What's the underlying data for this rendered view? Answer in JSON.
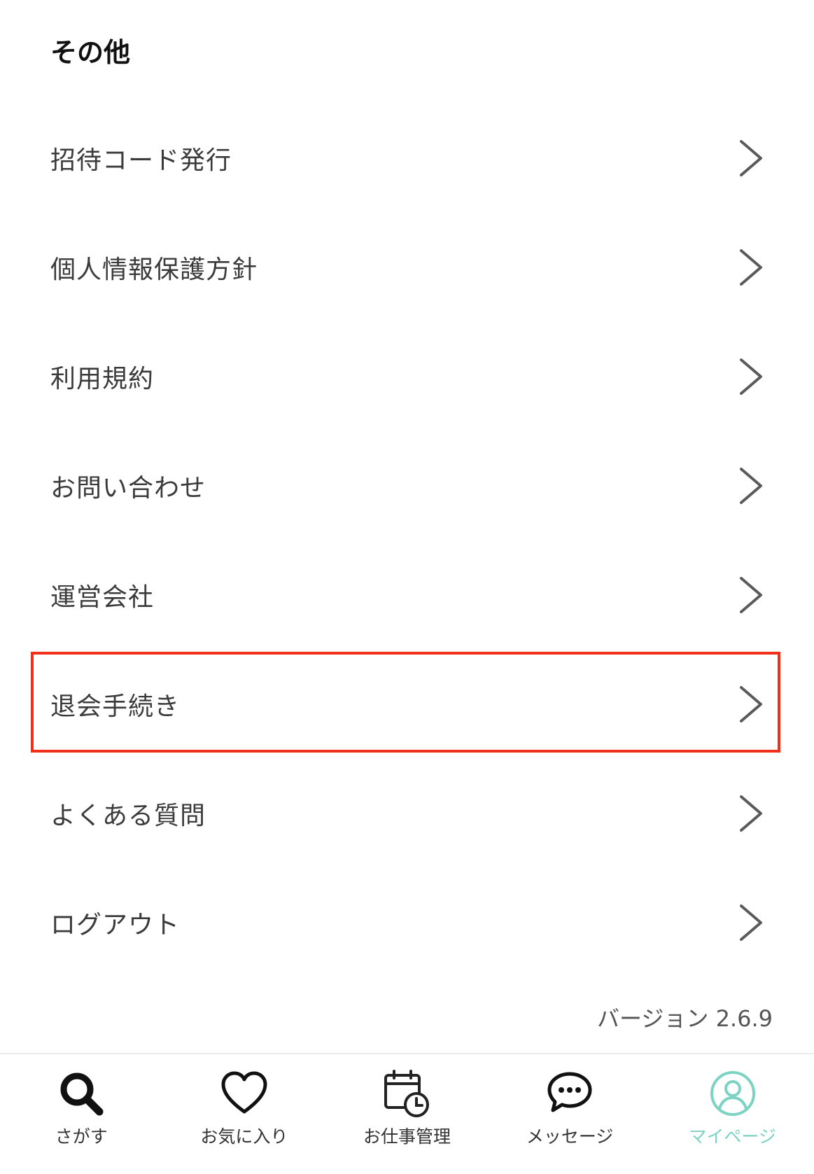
{
  "section": {
    "title": "その他"
  },
  "menu": {
    "items": [
      {
        "label": "招待コード発行"
      },
      {
        "label": "個人情報保護方針"
      },
      {
        "label": "利用規約"
      },
      {
        "label": "お問い合わせ"
      },
      {
        "label": "運営会社"
      },
      {
        "label": "退会手続き",
        "highlighted": true
      },
      {
        "label": "よくある質問"
      },
      {
        "label": "ログアウト"
      }
    ]
  },
  "version": {
    "text": "バージョン 2.6.9"
  },
  "colors": {
    "highlight": "#f2301a",
    "active_tab": "#7dd3c3",
    "chevron": "#555555"
  },
  "tabbar": {
    "tabs": [
      {
        "label": "さがす",
        "icon": "search-icon"
      },
      {
        "label": "お気に入り",
        "icon": "heart-icon"
      },
      {
        "label": "お仕事管理",
        "icon": "calendar-clock-icon"
      },
      {
        "label": "メッセージ",
        "icon": "chat-bubble-icon"
      },
      {
        "label": "マイページ",
        "icon": "user-icon",
        "active": true
      }
    ]
  }
}
